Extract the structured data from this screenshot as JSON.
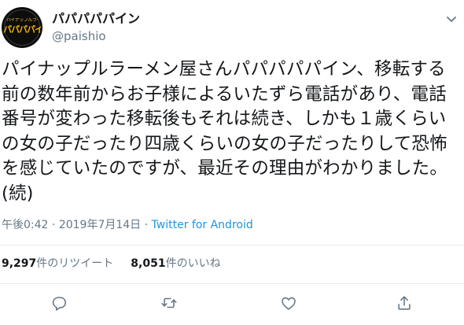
{
  "user": {
    "display_name": "パパパパパイン",
    "handle": "@paishio",
    "avatar_top_text": "パイナップルラーメン屋さん",
    "avatar_main_text": "パパパパイン"
  },
  "tweet": {
    "lines": [
      "パイナップルラーメン屋さんパパパパパイン、移転する",
      "前の数年前からお子様によるいたずら電話があり、電話",
      "番号が変わった移転後もそれは続き、しかも１歳くらい",
      "の女の子だったり四歳くらいの女の子だったりして恐怖",
      "を感じていたのですが、最近その理由がわかりました。",
      "(続)"
    ],
    "time": "午後0:42",
    "separator": "·",
    "date": "2019年7月14日",
    "source": "Twitter for Android"
  },
  "stats": {
    "retweets_count": "9,297",
    "retweets_label": "件のリツイート",
    "likes_count": "8,051",
    "likes_label": "件のいいね"
  },
  "icons": {
    "caret": "chevron-down-icon",
    "reply": "reply-icon",
    "retweet": "retweet-icon",
    "like": "heart-icon",
    "share": "share-icon"
  },
  "colors": {
    "text": "#14171a",
    "secondary": "#657786",
    "link": "#1b95e0",
    "divider": "#e6ecf0"
  }
}
